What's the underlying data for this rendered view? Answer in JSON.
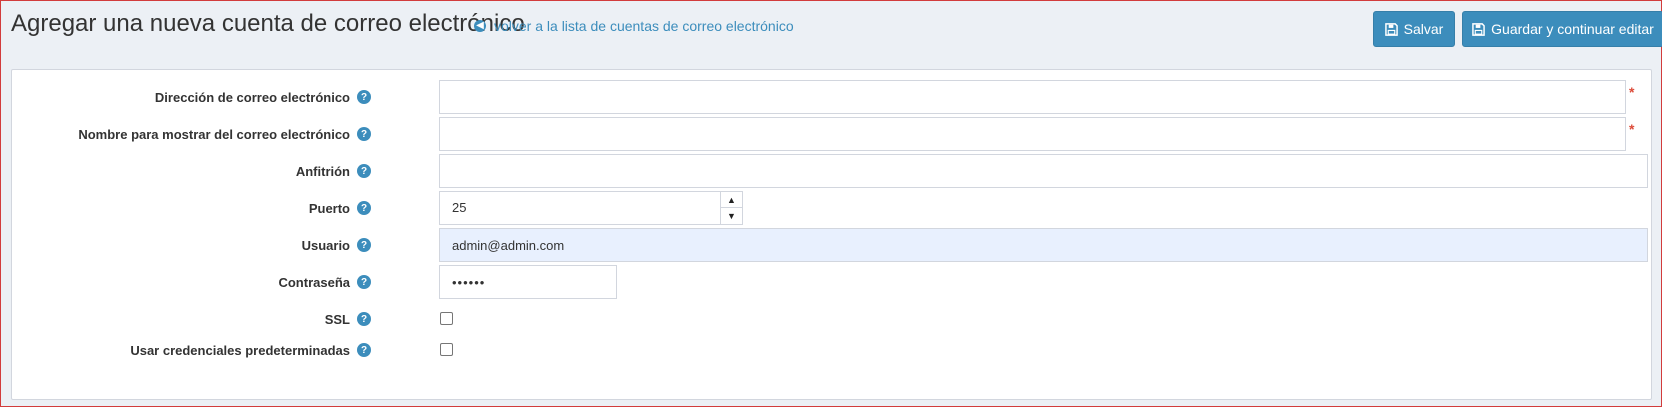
{
  "header": {
    "title": "Agregar una nueva cuenta de correo electrónico",
    "back_link": "volver a la lista de cuentas de correo electrónico",
    "save_label": "Salvar",
    "save_continue_label": "Guardar y continuar editar"
  },
  "form": {
    "email": {
      "label": "Dirección de correo electrónico",
      "value": "",
      "required_mark": "*"
    },
    "display_name": {
      "label": "Nombre para mostrar del correo electrónico",
      "value": "",
      "required_mark": "*"
    },
    "host": {
      "label": "Anfitrión",
      "value": ""
    },
    "port": {
      "label": "Puerto",
      "value": "25"
    },
    "username": {
      "label": "Usuario",
      "value": "admin@admin.com"
    },
    "password": {
      "label": "Contraseña",
      "value": "••••••"
    },
    "ssl": {
      "label": "SSL",
      "checked": false
    },
    "default_credentials": {
      "label": "Usar credenciales predeterminadas",
      "checked": false
    }
  },
  "colors": {
    "primary": "#3c8dbc",
    "required": "#dd4b39",
    "autofill": "#e8f0fe",
    "background": "#ecf0f5"
  },
  "icons": {
    "back": "arrow-circle-left-icon",
    "save": "floppy-disk-icon",
    "help": "question-circle-icon"
  }
}
